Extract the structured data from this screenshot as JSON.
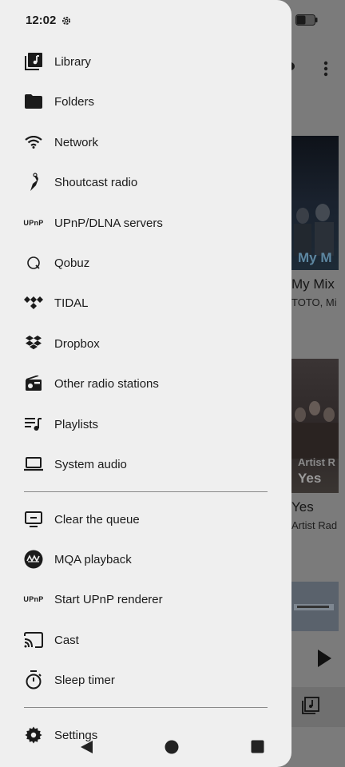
{
  "status_bar": {
    "time": "12:02"
  },
  "menu": {
    "items": [
      {
        "label": "Library",
        "icon": "library-music-icon"
      },
      {
        "label": "Folders",
        "icon": "folder-icon"
      },
      {
        "label": "Network",
        "icon": "wifi-icon"
      },
      {
        "label": "Shoutcast radio",
        "icon": "shoutcast-icon"
      },
      {
        "label": "UPnP/DLNA servers",
        "icon": "upnp-icon"
      },
      {
        "label": "Qobuz",
        "icon": "qobuz-icon"
      },
      {
        "label": "TIDAL",
        "icon": "tidal-icon"
      },
      {
        "label": "Dropbox",
        "icon": "dropbox-icon"
      },
      {
        "label": "Other radio stations",
        "icon": "radio-icon"
      },
      {
        "label": "Playlists",
        "icon": "playlist-icon"
      },
      {
        "label": "System audio",
        "icon": "laptop-icon"
      }
    ],
    "actions": [
      {
        "label": "Clear the queue",
        "icon": "tv-queue-icon"
      },
      {
        "label": "MQA playback",
        "icon": "mqa-icon"
      },
      {
        "label": "Start UPnP renderer",
        "icon": "upnp-icon"
      },
      {
        "label": "Cast",
        "icon": "cast-icon"
      },
      {
        "label": "Sleep timer",
        "icon": "timer-icon"
      }
    ],
    "settings": {
      "label": "Settings",
      "icon": "gear-icon"
    }
  },
  "background": {
    "card1": {
      "overlay": "My M",
      "title": "My Mix",
      "subtitle": "TOTO, Mi"
    },
    "card2": {
      "overlay_small": "Artist R",
      "overlay": "Yes",
      "title": "Yes",
      "subtitle": "Artist Rad"
    }
  },
  "icons": {
    "upnp_text": "UPnP"
  }
}
